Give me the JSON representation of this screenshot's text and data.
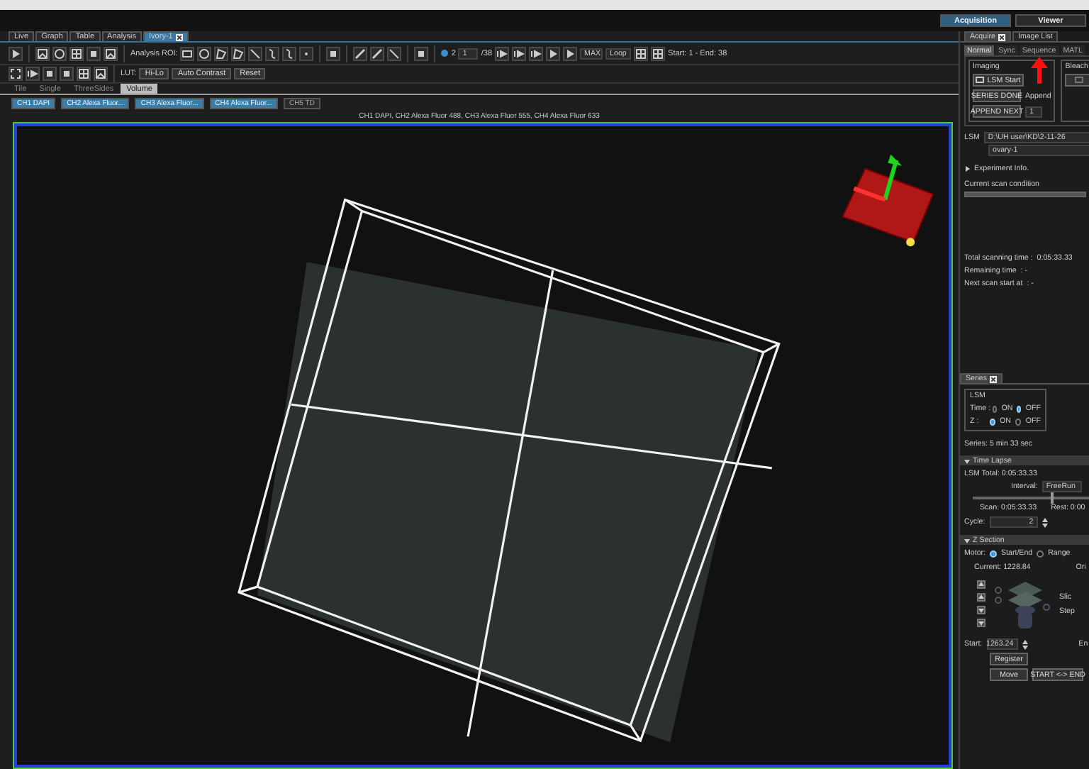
{
  "mode_buttons": [
    {
      "label": "Acquisition",
      "selected": true
    },
    {
      "label": "Viewer",
      "selected": false
    }
  ],
  "doc_tabs": [
    {
      "label": "Live",
      "selected": false
    },
    {
      "label": "Graph",
      "selected": false
    },
    {
      "label": "Table",
      "selected": false
    },
    {
      "label": "Analysis",
      "selected": false
    },
    {
      "label": "Ivory-1",
      "selected": true
    }
  ],
  "toolbar": {
    "roi_label": "Analysis ROI:",
    "z_value": "2",
    "frame_value": "1",
    "frame_total": "/38",
    "projection": "MAX",
    "playback": "Loop",
    "range": "Start: 1 - End: 38"
  },
  "toolbar2": {
    "lut_label": "LUT:",
    "buttons": [
      "Hi-Lo",
      "Auto Contrast",
      "Reset"
    ]
  },
  "view_tabs": [
    {
      "label": "Tile",
      "selected": false
    },
    {
      "label": "Single",
      "selected": false
    },
    {
      "label": "ThreeSides",
      "selected": false
    },
    {
      "label": "Volume",
      "selected": true
    }
  ],
  "channels": [
    {
      "label": "CH1 DAPI",
      "on": true
    },
    {
      "label": "CH2 Alexa Fluor...",
      "on": true
    },
    {
      "label": "CH3 Alexa Fluor...",
      "on": true
    },
    {
      "label": "CH4 Alexa Fluor...",
      "on": true
    },
    {
      "label": "CH5 TD",
      "on": false
    }
  ],
  "caption": "CH1 DAPI, CH2 Alexa Fluor 488, CH3 Alexa Fluor 555, CH4 Alexa Fluor 633",
  "acquire": {
    "panel_tabs": [
      {
        "label": "Acquire",
        "selected": true
      },
      {
        "label": "Image List",
        "selected": false
      }
    ],
    "sub_tabs": [
      {
        "label": "Normal",
        "selected": true
      },
      {
        "label": "Sync",
        "selected": false
      },
      {
        "label": "Sequence",
        "selected": false
      },
      {
        "label": "MATL",
        "selected": false
      }
    ],
    "imaging_title": "Imaging",
    "start_button": "LSM Start",
    "series_done": "SERIES DONE",
    "append": "Append",
    "append_next": "APPEND NEXT",
    "append_count": "1",
    "bleach_title": "Bleach",
    "lsm_label": "LSM",
    "path": "D:\\UH user\\KD\\2-11-26",
    "name": "ovary-1",
    "experiment_info": "Experiment Info.",
    "scan_condition": "Current scan condition",
    "times": [
      {
        "label": "Total scanning time :",
        "value": "0:05:33.33"
      },
      {
        "label": "Remaining time",
        "value": ": -"
      },
      {
        "label": "Next scan start at",
        "value": ": -"
      }
    ]
  },
  "series": {
    "tab": "Series",
    "group": "LSM",
    "rows": [
      {
        "label": "Time :",
        "options": [
          {
            "label": "ON",
            "selected": false
          },
          {
            "label": "OFF",
            "selected": true
          }
        ]
      },
      {
        "label": "Z :",
        "options": [
          {
            "label": "ON",
            "selected": true
          },
          {
            "label": "OFF",
            "selected": false
          }
        ]
      }
    ],
    "summary": "Series: 5 min 33 sec"
  },
  "time_lapse": {
    "title": "Time Lapse",
    "total": "LSM Total: 0:05:33.33",
    "interval_label": "Interval:",
    "interval_value": "FreeRun",
    "level": 0.6,
    "scan": "Scan: 0:05:33.33",
    "rest": "Rest: 0:00",
    "cycle_label": "Cycle:",
    "cycle_value": "2"
  },
  "z_section": {
    "title": "Z Section",
    "motor_label": "Motor:",
    "motor_options": [
      {
        "label": "Start/End",
        "selected": true
      },
      {
        "label": "Range",
        "selected": false
      }
    ],
    "current": "Current: 1228.84",
    "origin": "Ori",
    "slice": "Slic",
    "step": "Step",
    "start_label": "Start:",
    "start_value": "1263.24",
    "end_label": "En",
    "register": "Register",
    "move": "Move",
    "swap": "START <-> END"
  }
}
